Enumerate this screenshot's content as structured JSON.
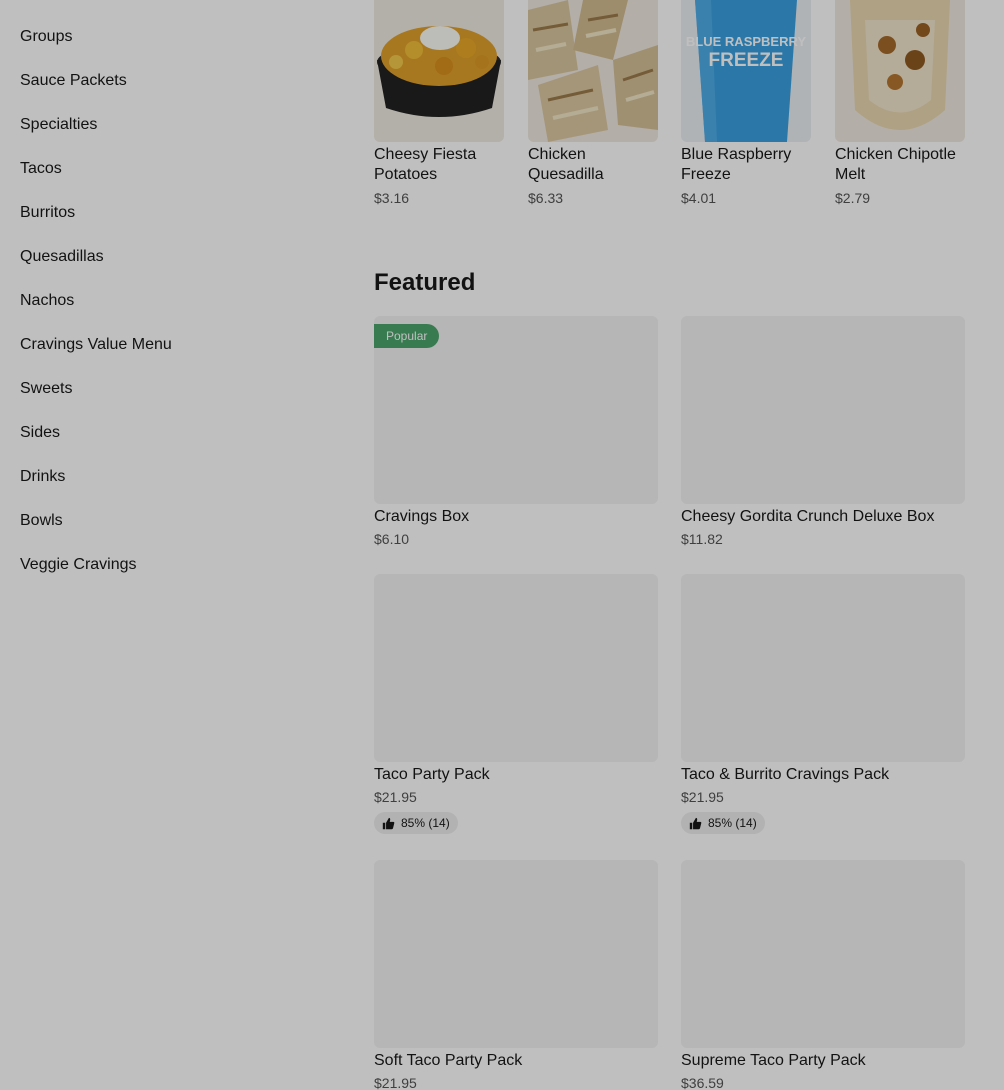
{
  "sidebar": {
    "items": [
      {
        "label": "Groups"
      },
      {
        "label": "Sauce Packets"
      },
      {
        "label": "Specialties"
      },
      {
        "label": "Tacos"
      },
      {
        "label": "Burritos"
      },
      {
        "label": "Quesadillas"
      },
      {
        "label": "Nachos"
      },
      {
        "label": "Cravings Value Menu"
      },
      {
        "label": "Sweets"
      },
      {
        "label": "Sides"
      },
      {
        "label": "Drinks"
      },
      {
        "label": "Bowls"
      },
      {
        "label": "Veggie Cravings"
      }
    ]
  },
  "carousel": {
    "items": [
      {
        "name": "Cheesy Fiesta Potatoes",
        "price": "$3.16",
        "icon": "potatoes-image"
      },
      {
        "name": "Chicken Quesadilla",
        "price": "$6.33",
        "icon": "quesadilla-image"
      },
      {
        "name": "Blue Raspberry Freeze",
        "price": "$4.01",
        "icon": "drink-image",
        "cup_text_1": "BLUE RASPBERRY",
        "cup_text_2": "FREEZE"
      },
      {
        "name": "Chicken Chipotle Melt",
        "price": "$2.79",
        "icon": "melt-image"
      }
    ]
  },
  "featured": {
    "title": "Featured",
    "items": [
      {
        "name": "Cravings Box",
        "price": "$6.10",
        "badge": "Popular"
      },
      {
        "name": "Cheesy Gordita Crunch Deluxe Box",
        "price": "$11.82"
      },
      {
        "name": "Taco Party Pack",
        "price": "$21.95",
        "rating": "85% (14)"
      },
      {
        "name": "Taco & Burrito Cravings Pack",
        "price": "$21.95",
        "rating": "85% (14)"
      },
      {
        "name": "Soft Taco Party Pack",
        "price": "$21.95"
      },
      {
        "name": "Supreme Taco Party Pack",
        "price": "$36.59"
      }
    ]
  },
  "colors": {
    "badge": "#4ca56d",
    "drink": "#3aa0e0",
    "overlay": "rgba(0,0,0,0.25)"
  }
}
